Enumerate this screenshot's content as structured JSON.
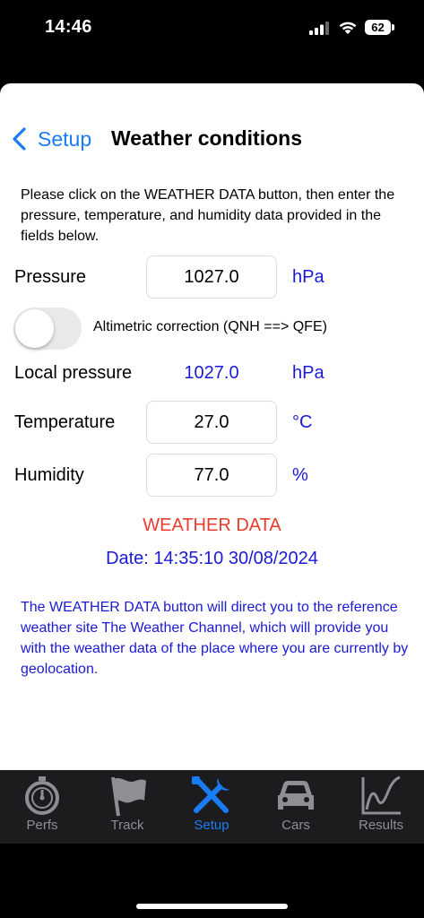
{
  "status": {
    "time": "14:46",
    "battery": "62"
  },
  "nav": {
    "back_label": "Setup",
    "title": "Weather conditions"
  },
  "intro_text": "Please click on the WEATHER DATA button, then enter the pressure, temperature, and humidity data provided in the fields below.",
  "pressure": {
    "label": "Pressure",
    "value": "1027.0",
    "unit": "hPa"
  },
  "altimetric": {
    "label": "Altimetric correction (QNH ==> QFE)",
    "enabled": false
  },
  "local_pressure": {
    "label": "Local pressure",
    "value": "1027.0",
    "unit": "hPa"
  },
  "temperature": {
    "label": "Temperature",
    "value": "27.0",
    "unit": "°C"
  },
  "humidity": {
    "label": "Humidity",
    "value": "77.0",
    "unit": "%"
  },
  "weather_button": "WEATHER DATA",
  "date_line": "Date: 14:35:10 30/08/2024",
  "note_text": "The WEATHER DATA button will direct you to the reference weather site The Weather Channel, which will provide you with the weather data of the place where you are currently by geolocation.",
  "tabs": [
    {
      "label": "Perfs",
      "icon": "stopwatch-icon"
    },
    {
      "label": "Track",
      "icon": "flag-icon"
    },
    {
      "label": "Setup",
      "icon": "wrench-screwdriver-icon"
    },
    {
      "label": "Cars",
      "icon": "car-icon"
    },
    {
      "label": "Results",
      "icon": "chart-icon"
    }
  ],
  "colors": {
    "accent_blue": "#1a7cf4",
    "value_blue": "#1a1ad6",
    "button_red": "#ea3b2f",
    "tab_inactive": "#8e8e93"
  }
}
